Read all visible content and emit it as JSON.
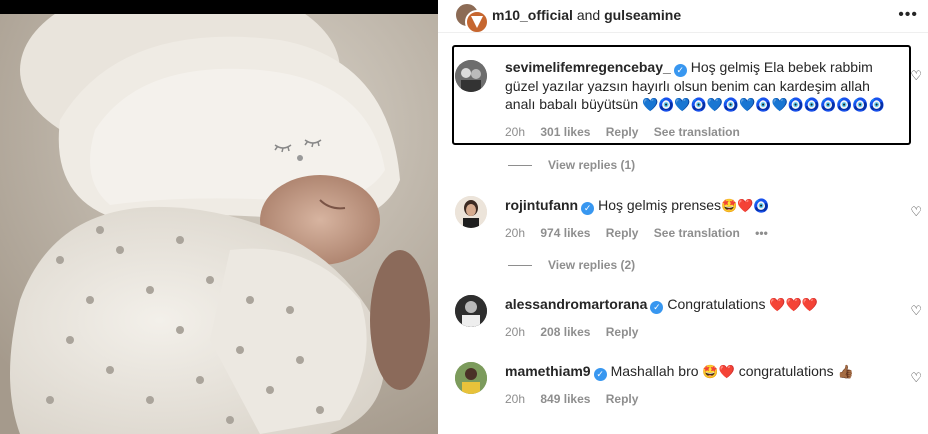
{
  "header": {
    "user1": "m10_official",
    "and_text": "and",
    "user2": "gulseamine",
    "more_icon": "more-horizontal-icon"
  },
  "comments": [
    {
      "username": "sevimelifemregencebay_",
      "verified": true,
      "text": "Hoş gelmiş Ela bebek rabbim güzel yazılar yazsın hayırlı olsun benim can kardeşim allah analı babalı büyütsün",
      "emoji": "💙🧿💙🧿💙🧿💙🧿💙🧿🧿🧿🧿🧿🧿",
      "time": "20h",
      "likes": "301 likes",
      "reply": "Reply",
      "translation": "See translation",
      "view_replies": "View replies (1)"
    },
    {
      "username": "rojintufann",
      "verified": true,
      "text": "Hoş gelmiş prenses",
      "emoji": "🤩❤️🧿",
      "time": "20h",
      "likes": "974 likes",
      "reply": "Reply",
      "translation": "See translation",
      "more": "•••",
      "view_replies": "View replies (2)"
    },
    {
      "username": "alessandromartorana",
      "verified": true,
      "text": "Congratulations",
      "emoji": "❤️❤️❤️",
      "time": "20h",
      "likes": "208 likes",
      "reply": "Reply"
    },
    {
      "username": "mamethiam9",
      "verified": true,
      "text": "Mashallah bro",
      "emoji": "🤩❤️",
      "text2": "congratulations",
      "emoji2": "👍🏾",
      "time": "20h",
      "likes": "849 likes",
      "reply": "Reply"
    }
  ],
  "icons": {
    "like": "heart-outline-icon",
    "verified": "verified-badge-icon"
  },
  "colors": {
    "verified": "#3897f0",
    "muted": "#8e8e8e",
    "text": "#262626"
  }
}
